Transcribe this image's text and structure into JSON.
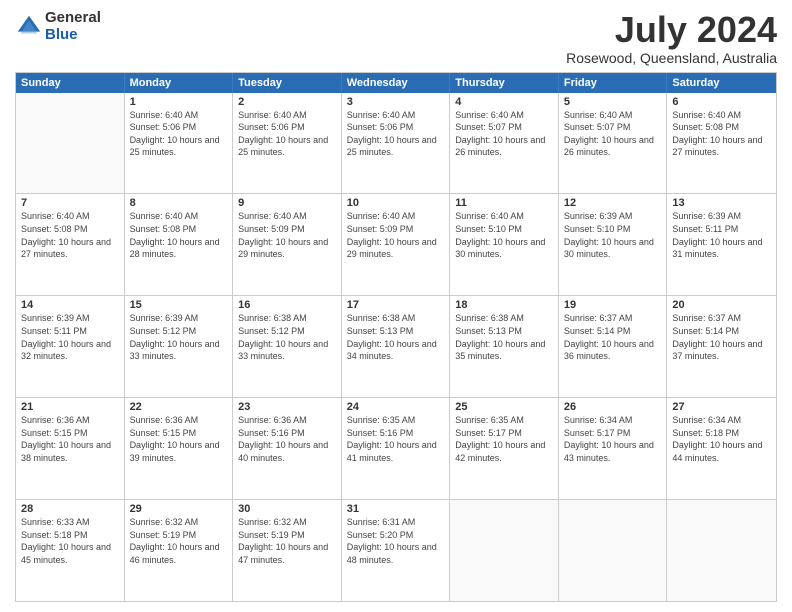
{
  "logo": {
    "general": "General",
    "blue": "Blue"
  },
  "title": {
    "month": "July 2024",
    "location": "Rosewood, Queensland, Australia"
  },
  "header_days": [
    "Sunday",
    "Monday",
    "Tuesday",
    "Wednesday",
    "Thursday",
    "Friday",
    "Saturday"
  ],
  "weeks": [
    [
      {
        "day": "",
        "empty": true
      },
      {
        "day": "1",
        "sunrise": "Sunrise: 6:40 AM",
        "sunset": "Sunset: 5:06 PM",
        "daylight": "Daylight: 10 hours and 25 minutes."
      },
      {
        "day": "2",
        "sunrise": "Sunrise: 6:40 AM",
        "sunset": "Sunset: 5:06 PM",
        "daylight": "Daylight: 10 hours and 25 minutes."
      },
      {
        "day": "3",
        "sunrise": "Sunrise: 6:40 AM",
        "sunset": "Sunset: 5:06 PM",
        "daylight": "Daylight: 10 hours and 25 minutes."
      },
      {
        "day": "4",
        "sunrise": "Sunrise: 6:40 AM",
        "sunset": "Sunset: 5:07 PM",
        "daylight": "Daylight: 10 hours and 26 minutes."
      },
      {
        "day": "5",
        "sunrise": "Sunrise: 6:40 AM",
        "sunset": "Sunset: 5:07 PM",
        "daylight": "Daylight: 10 hours and 26 minutes."
      },
      {
        "day": "6",
        "sunrise": "Sunrise: 6:40 AM",
        "sunset": "Sunset: 5:08 PM",
        "daylight": "Daylight: 10 hours and 27 minutes."
      }
    ],
    [
      {
        "day": "7",
        "sunrise": "Sunrise: 6:40 AM",
        "sunset": "Sunset: 5:08 PM",
        "daylight": "Daylight: 10 hours and 27 minutes."
      },
      {
        "day": "8",
        "sunrise": "Sunrise: 6:40 AM",
        "sunset": "Sunset: 5:08 PM",
        "daylight": "Daylight: 10 hours and 28 minutes."
      },
      {
        "day": "9",
        "sunrise": "Sunrise: 6:40 AM",
        "sunset": "Sunset: 5:09 PM",
        "daylight": "Daylight: 10 hours and 29 minutes."
      },
      {
        "day": "10",
        "sunrise": "Sunrise: 6:40 AM",
        "sunset": "Sunset: 5:09 PM",
        "daylight": "Daylight: 10 hours and 29 minutes."
      },
      {
        "day": "11",
        "sunrise": "Sunrise: 6:40 AM",
        "sunset": "Sunset: 5:10 PM",
        "daylight": "Daylight: 10 hours and 30 minutes."
      },
      {
        "day": "12",
        "sunrise": "Sunrise: 6:39 AM",
        "sunset": "Sunset: 5:10 PM",
        "daylight": "Daylight: 10 hours and 30 minutes."
      },
      {
        "day": "13",
        "sunrise": "Sunrise: 6:39 AM",
        "sunset": "Sunset: 5:11 PM",
        "daylight": "Daylight: 10 hours and 31 minutes."
      }
    ],
    [
      {
        "day": "14",
        "sunrise": "Sunrise: 6:39 AM",
        "sunset": "Sunset: 5:11 PM",
        "daylight": "Daylight: 10 hours and 32 minutes."
      },
      {
        "day": "15",
        "sunrise": "Sunrise: 6:39 AM",
        "sunset": "Sunset: 5:12 PM",
        "daylight": "Daylight: 10 hours and 33 minutes."
      },
      {
        "day": "16",
        "sunrise": "Sunrise: 6:38 AM",
        "sunset": "Sunset: 5:12 PM",
        "daylight": "Daylight: 10 hours and 33 minutes."
      },
      {
        "day": "17",
        "sunrise": "Sunrise: 6:38 AM",
        "sunset": "Sunset: 5:13 PM",
        "daylight": "Daylight: 10 hours and 34 minutes."
      },
      {
        "day": "18",
        "sunrise": "Sunrise: 6:38 AM",
        "sunset": "Sunset: 5:13 PM",
        "daylight": "Daylight: 10 hours and 35 minutes."
      },
      {
        "day": "19",
        "sunrise": "Sunrise: 6:37 AM",
        "sunset": "Sunset: 5:14 PM",
        "daylight": "Daylight: 10 hours and 36 minutes."
      },
      {
        "day": "20",
        "sunrise": "Sunrise: 6:37 AM",
        "sunset": "Sunset: 5:14 PM",
        "daylight": "Daylight: 10 hours and 37 minutes."
      }
    ],
    [
      {
        "day": "21",
        "sunrise": "Sunrise: 6:36 AM",
        "sunset": "Sunset: 5:15 PM",
        "daylight": "Daylight: 10 hours and 38 minutes."
      },
      {
        "day": "22",
        "sunrise": "Sunrise: 6:36 AM",
        "sunset": "Sunset: 5:15 PM",
        "daylight": "Daylight: 10 hours and 39 minutes."
      },
      {
        "day": "23",
        "sunrise": "Sunrise: 6:36 AM",
        "sunset": "Sunset: 5:16 PM",
        "daylight": "Daylight: 10 hours and 40 minutes."
      },
      {
        "day": "24",
        "sunrise": "Sunrise: 6:35 AM",
        "sunset": "Sunset: 5:16 PM",
        "daylight": "Daylight: 10 hours and 41 minutes."
      },
      {
        "day": "25",
        "sunrise": "Sunrise: 6:35 AM",
        "sunset": "Sunset: 5:17 PM",
        "daylight": "Daylight: 10 hours and 42 minutes."
      },
      {
        "day": "26",
        "sunrise": "Sunrise: 6:34 AM",
        "sunset": "Sunset: 5:17 PM",
        "daylight": "Daylight: 10 hours and 43 minutes."
      },
      {
        "day": "27",
        "sunrise": "Sunrise: 6:34 AM",
        "sunset": "Sunset: 5:18 PM",
        "daylight": "Daylight: 10 hours and 44 minutes."
      }
    ],
    [
      {
        "day": "28",
        "sunrise": "Sunrise: 6:33 AM",
        "sunset": "Sunset: 5:18 PM",
        "daylight": "Daylight: 10 hours and 45 minutes."
      },
      {
        "day": "29",
        "sunrise": "Sunrise: 6:32 AM",
        "sunset": "Sunset: 5:19 PM",
        "daylight": "Daylight: 10 hours and 46 minutes."
      },
      {
        "day": "30",
        "sunrise": "Sunrise: 6:32 AM",
        "sunset": "Sunset: 5:19 PM",
        "daylight": "Daylight: 10 hours and 47 minutes."
      },
      {
        "day": "31",
        "sunrise": "Sunrise: 6:31 AM",
        "sunset": "Sunset: 5:20 PM",
        "daylight": "Daylight: 10 hours and 48 minutes."
      },
      {
        "day": "",
        "empty": true
      },
      {
        "day": "",
        "empty": true
      },
      {
        "day": "",
        "empty": true
      }
    ]
  ]
}
